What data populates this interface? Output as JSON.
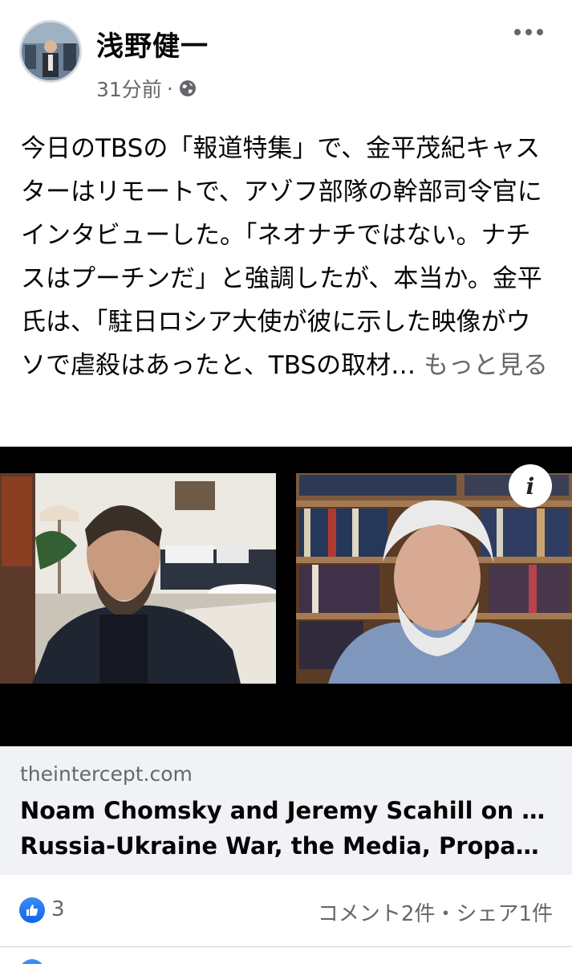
{
  "post": {
    "author": "浅野健一",
    "time": "31分前",
    "separator": "·",
    "privacy_icon": "globe-icon",
    "text": "今日のTBSの「報道特集」で、金平茂紀キャスターはリモートで、アゾフ部隊の幹部司令官にインタビューした。「ネオナチではない。ナチスはプーチンだ」と強調したが、本当か。金平氏は、「駐日ロシア大使が彼に示した映像がウソで虐殺はあったと、TBSの取材…",
    "see_more": " もっと見る",
    "more_icon": "more-options-icon"
  },
  "link": {
    "domain": "theintercept.com",
    "title_line1": "Noam Chomsky and Jeremy Scahill on the",
    "title_line2": "Russia-Ukraine War, the Media, Propagan…",
    "info_icon": "info-icon",
    "info_label": "i"
  },
  "stats": {
    "like_icon": "thumbs-up-icon",
    "like_count": "3",
    "comment_share": "コメント2件・シェア1件"
  },
  "colors": {
    "accent": "#1877f2",
    "secondary_text": "#65676b",
    "card_bg": "#f0f2f5"
  }
}
